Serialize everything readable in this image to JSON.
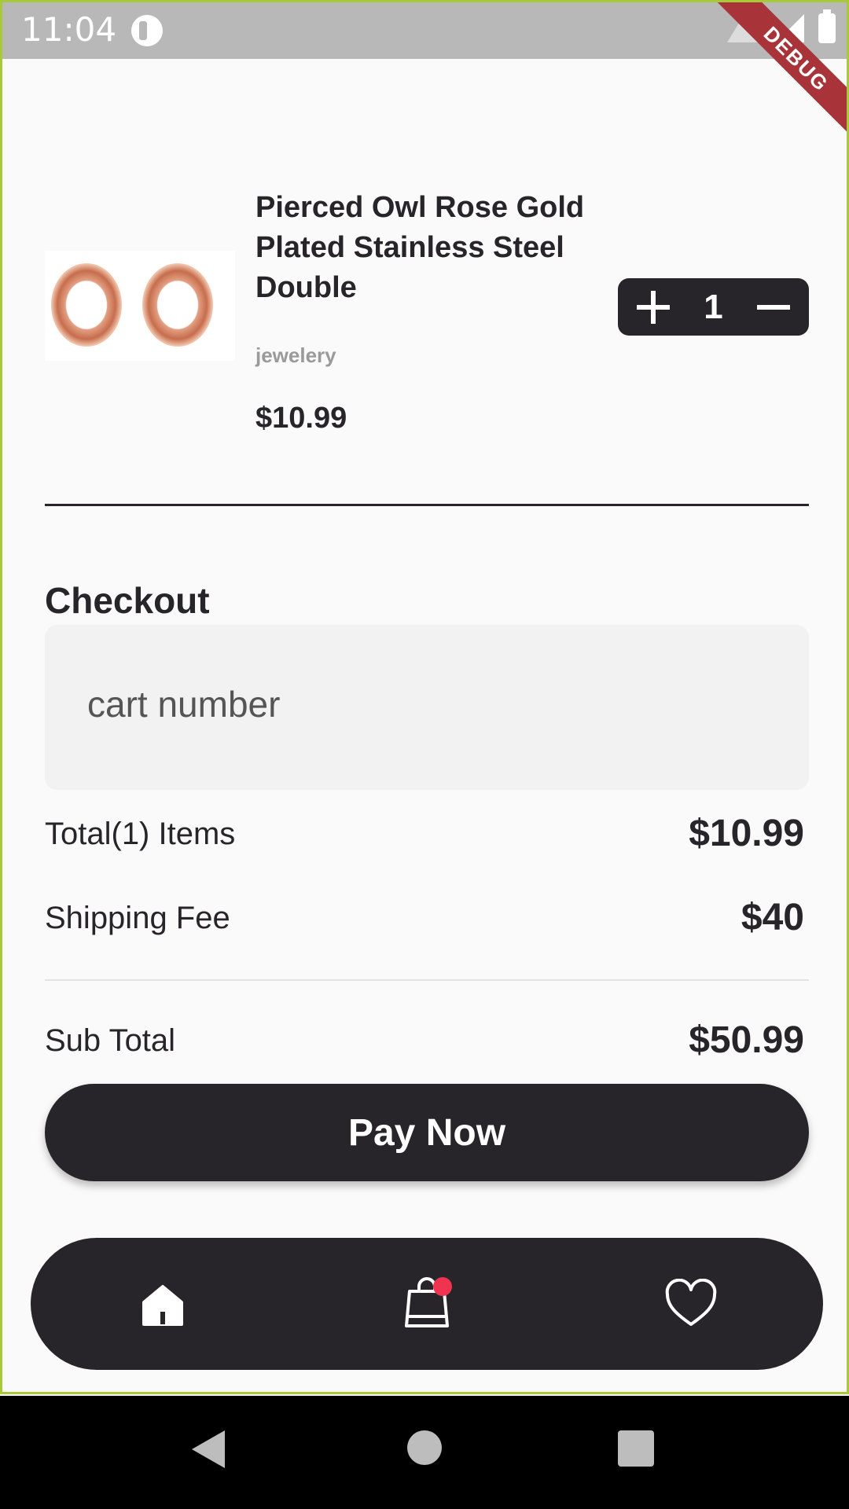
{
  "status_bar": {
    "time": "11:04"
  },
  "debug_label": "DEBUG",
  "product": {
    "title": "Pierced Owl Rose Gold Plated Stainless Steel Double",
    "category": "jewelery",
    "price": "$10.99",
    "quantity": "1"
  },
  "checkout": {
    "title": "Checkout",
    "cart_placeholder": "cart number",
    "total_items_label": "Total(1) Items",
    "total_items_value": "$10.99",
    "shipping_label": "Shipping Fee",
    "shipping_value": "$40",
    "subtotal_label": "Sub Total",
    "subtotal_value": "$50.99",
    "pay_label": "Pay Now"
  },
  "bottom_nav": {
    "items": [
      "home-icon",
      "shopping-bag-icon",
      "heart-icon"
    ],
    "active_badge_color": "#f0344f"
  },
  "colors": {
    "primary": "#27252a",
    "background": "#fafafa"
  }
}
